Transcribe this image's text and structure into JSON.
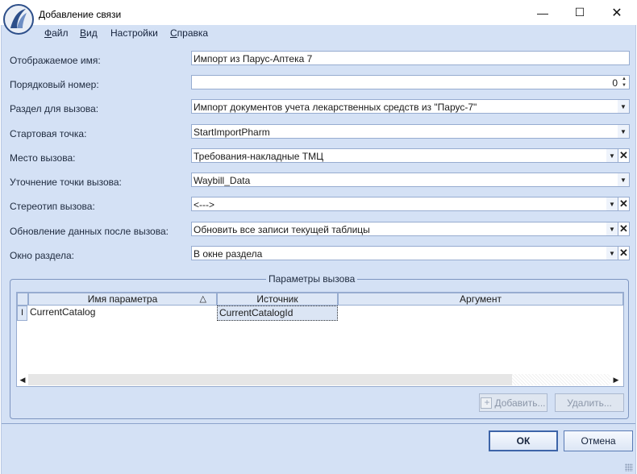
{
  "window": {
    "title": "Добавление связи",
    "minimize_glyph": "—",
    "maximize_glyph": "☐",
    "close_glyph": "✕"
  },
  "menu": {
    "items": [
      {
        "label_accel": "Ф",
        "label_rest": "айл"
      },
      {
        "label_accel": "В",
        "label_rest": "ид"
      },
      {
        "label_accel": "",
        "label_rest": "Настройки"
      },
      {
        "label_accel": "С",
        "label_rest": "правка"
      }
    ]
  },
  "form": {
    "display_name_label": "Отображаемое имя:",
    "display_name_value": "Импорт из Парус-Аптека 7",
    "order_label": "Порядковый номер:",
    "order_value": "0",
    "section_label": "Раздел для вызова:",
    "section_value": "Импорт документов учета лекарственных средств из \"Парус-7\"",
    "start_point_label": "Стартовая точка:",
    "start_point_value": "StartImportPharm",
    "call_place_label": "Место вызова:",
    "call_place_value": "Требования-накладные ТМЦ",
    "call_point_spec_label": "Уточнение точки вызова:",
    "call_point_spec_value": "Waybill_Data",
    "stereotype_label": "Стереотип вызова:",
    "stereotype_value": "<--->",
    "refresh_label": "Обновление данных после вызова:",
    "refresh_value": "Обновить все записи текущей таблицы",
    "window_label": "Окно раздела:",
    "window_value": "В окне раздела"
  },
  "params": {
    "group_title": "Параметры вызова",
    "columns": [
      "Имя параметра",
      "Источник",
      "Аргумент"
    ],
    "rows": [
      {
        "name": "CurrentCatalog",
        "source": "CurrentCatalogId",
        "argument": ""
      }
    ],
    "add_label": "Добавить...",
    "delete_label": "Удалить..."
  },
  "buttons": {
    "ok": "ОК",
    "cancel": "Отмена"
  },
  "glyphs": {
    "dropdown": "▼",
    "clear": "✕",
    "spin_up": "▲",
    "spin_down": "▼",
    "sort": "△",
    "row_cursor": "I",
    "scroll_left": "◀",
    "scroll_right": "▶"
  },
  "colors": {
    "client_bg": "#d4e1f5",
    "field_border": "#97acd0"
  }
}
